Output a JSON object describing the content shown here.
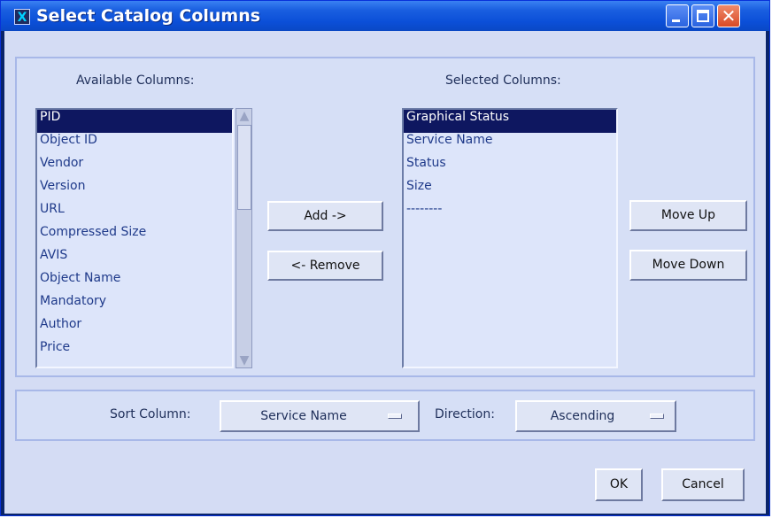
{
  "window": {
    "title": "Select Catalog Columns",
    "app_icon_glyph": "X",
    "minimize_glyph": "",
    "close_glyph": "✕"
  },
  "available": {
    "label": "Available Columns:",
    "items": [
      "PID",
      "Object ID",
      "Vendor",
      "Version",
      "URL",
      "Compressed Size",
      "AVIS",
      "Object Name",
      "Mandatory",
      "Author",
      "Price"
    ],
    "selected_index": 0
  },
  "selected": {
    "label": "Selected Columns:",
    "items": [
      "Graphical Status",
      "Service Name",
      "Status",
      "Size",
      "--------"
    ],
    "selected_index": 0
  },
  "buttons": {
    "add": "Add ->",
    "remove": "<- Remove",
    "move_up": "Move Up",
    "move_down": "Move Down",
    "ok": "OK",
    "cancel": "Cancel"
  },
  "sort": {
    "column_label": "Sort Column:",
    "column_value": "Service Name",
    "direction_label": "Direction:",
    "direction_value": "Ascending"
  },
  "icons": {
    "scroll_up": "scroll-up-arrow-icon",
    "scroll_down": "scroll-down-arrow-icon",
    "dropdown": "dropdown-indicator-icon"
  },
  "colors": {
    "title_bar": "#0b4fd8",
    "selection": "#0e1760",
    "panel": "#d6dff6",
    "list_text": "#1f3a8a"
  }
}
